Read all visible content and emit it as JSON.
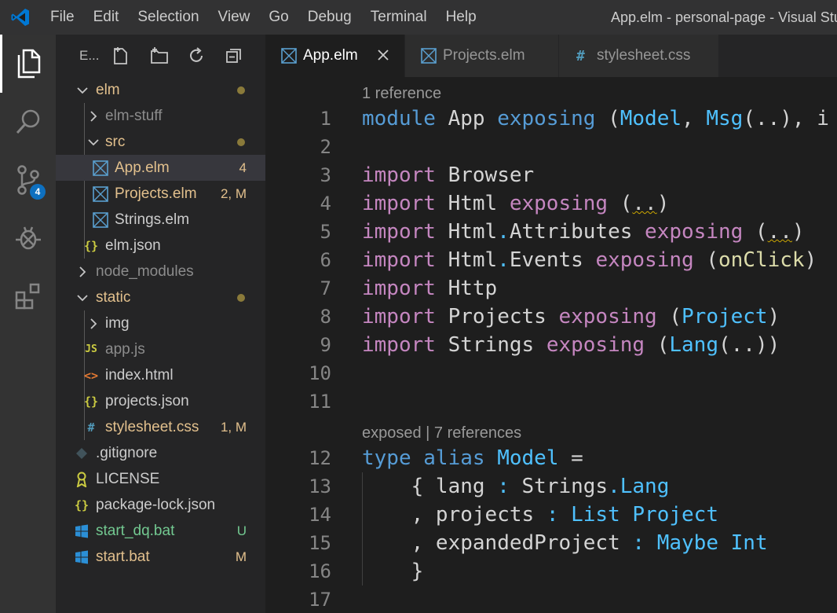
{
  "titlebar": {
    "menu": [
      "File",
      "Edit",
      "Selection",
      "View",
      "Go",
      "Debug",
      "Terminal",
      "Help"
    ],
    "window_title": "App.elm - personal-page - Visual Stu"
  },
  "activity": {
    "scm_badge": "4"
  },
  "sidebar": {
    "title": "E...",
    "tree": [
      {
        "label": "elm",
        "kind": "folder-open",
        "color": "#e2c08d",
        "dot": true
      },
      {
        "label": "elm-stuff",
        "kind": "folder-closed",
        "color": "#8c8c8c"
      },
      {
        "label": "src",
        "kind": "folder-open",
        "color": "#e2c08d",
        "dot": true
      },
      {
        "label": "App.elm",
        "kind": "elm",
        "color": "#e2c08d",
        "status": "4"
      },
      {
        "label": "Projects.elm",
        "kind": "elm",
        "color": "#e2c08d",
        "status": "2, M"
      },
      {
        "label": "Strings.elm",
        "kind": "elm",
        "color": "#cccccc"
      },
      {
        "label": "elm.json",
        "kind": "json",
        "color": "#cccccc"
      },
      {
        "label": "node_modules",
        "kind": "folder-closed",
        "color": "#8c8c8c"
      },
      {
        "label": "static",
        "kind": "folder-open",
        "color": "#e2c08d",
        "dot": true
      },
      {
        "label": "img",
        "kind": "folder-closed",
        "color": "#cccccc"
      },
      {
        "label": "app.js",
        "kind": "js",
        "color": "#8c8c8c"
      },
      {
        "label": "index.html",
        "kind": "html",
        "color": "#cccccc"
      },
      {
        "label": "projects.json",
        "kind": "json",
        "color": "#cccccc"
      },
      {
        "label": "stylesheet.css",
        "kind": "css",
        "color": "#e2c08d",
        "status": "1, M"
      },
      {
        "label": ".gitignore",
        "kind": "git",
        "color": "#cccccc"
      },
      {
        "label": "LICENSE",
        "kind": "license",
        "color": "#cccccc"
      },
      {
        "label": "package-lock.json",
        "kind": "json",
        "color": "#cccccc"
      },
      {
        "label": "start_dq.bat",
        "kind": "win",
        "color": "#73c991",
        "status": "U"
      },
      {
        "label": "start.bat",
        "kind": "win",
        "color": "#e2c08d",
        "status": "M"
      }
    ]
  },
  "tabs": [
    {
      "label": "App.elm",
      "icon": "elm-icon"
    },
    {
      "label": "Projects.elm",
      "icon": "elm-icon"
    },
    {
      "label": "stylesheet.css",
      "icon": "css-icon"
    }
  ],
  "editor": {
    "line_numbers": [
      "1",
      "2",
      "3",
      "4",
      "5",
      "6",
      "7",
      "8",
      "9",
      "10",
      "11",
      "12",
      "13",
      "14",
      "15",
      "16",
      "17"
    ],
    "lens_top": "1 reference",
    "lens_model": "exposed | 7 references",
    "lines": {
      "l1": [
        "module",
        " App ",
        "exposing",
        " (",
        "Model",
        ", ",
        "Msg",
        "(..), ",
        "i"
      ],
      "l3": [
        "import",
        " Browser"
      ],
      "l4": [
        "import",
        " Html ",
        "exposing",
        " (",
        "..",
        ")"
      ],
      "l5": [
        "import",
        " Html",
        ".",
        "Attributes ",
        "exposing",
        " (",
        "..",
        ")"
      ],
      "l6": [
        "import",
        " Html",
        ".",
        "Events ",
        "exposing",
        " (",
        "onClick",
        ")"
      ],
      "l7": [
        "import",
        " Http"
      ],
      "l8": [
        "import",
        " Projects ",
        "exposing",
        " (",
        "Project",
        ")"
      ],
      "l9": [
        "import",
        " Strings ",
        "exposing",
        " (",
        "Lang",
        "(..))"
      ],
      "l12": [
        "type",
        " ",
        "alias",
        " ",
        "Model",
        " ="
      ],
      "l13": [
        "    { ",
        "lang",
        " ",
        ":",
        " Strings",
        ".",
        "Lang"
      ],
      "l14": [
        "    , ",
        "projects",
        " ",
        ":",
        " ",
        "List",
        " ",
        "Project"
      ],
      "l15": [
        "    , ",
        "expandedProject",
        " ",
        ":",
        " ",
        "Maybe",
        " ",
        "Int"
      ],
      "l16": [
        "    }"
      ]
    }
  }
}
